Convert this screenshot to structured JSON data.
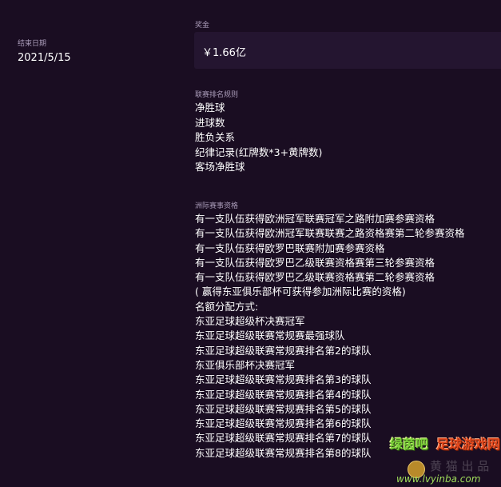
{
  "end_date": {
    "label": "结束日期",
    "value": "2021/5/15"
  },
  "prize": {
    "label": "奖金",
    "value": "￥1.66亿"
  },
  "league_ranking_rules": {
    "label": "联赛排名规则",
    "items": [
      "净胜球",
      "进球数",
      "胜负关系",
      "纪律记录(红牌数*3+黄牌数)",
      "客场净胜球"
    ]
  },
  "continental_qualification": {
    "label": "洲际赛事资格",
    "lines": [
      "有一支队伍获得欧洲冠军联赛冠军之路附加赛参赛资格",
      "有一支队伍获得欧洲冠军联赛联赛之路资格赛第二轮参赛资格",
      "有一支队伍获得欧罗巴联赛附加赛参赛资格",
      "有一支队伍获得欧罗巴乙级联赛资格赛第三轮参赛资格",
      "有一支队伍获得欧罗巴乙级联赛资格赛第二轮参赛资格",
      "( 赢得东亚俱乐部杯可获得参加洲际比赛的资格)",
      "名额分配方式:",
      "东亚足球超级杯决赛冠军",
      "东亚足球超级联赛常规赛最强球队",
      "东亚足球超级联赛常规赛排名第2的球队",
      "东亚俱乐部杯决赛冠军",
      "东亚足球超级联赛常规赛排名第3的球队",
      "东亚足球超级联赛常规赛排名第4的球队",
      "东亚足球超级联赛常规赛排名第5的球队",
      "东亚足球超级联赛常规赛排名第6的球队",
      "东亚足球超级联赛常规赛排名第7的球队",
      "东亚足球超级联赛常规赛排名第8的球队"
    ]
  },
  "watermark": {
    "logo_left": "绿茵吧",
    "logo_right": "足球游戏网",
    "faint_text": "黄 猫 出 品",
    "url": "www.lvyinba.com"
  }
}
